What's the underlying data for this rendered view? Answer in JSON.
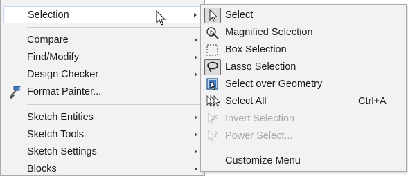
{
  "left_menu": {
    "items": [
      {
        "label": "Selection",
        "has_submenu": true,
        "highlighted": true
      },
      {
        "label": "Compare",
        "has_submenu": true
      },
      {
        "label": "Find/Modify",
        "has_submenu": true
      },
      {
        "label": "Design Checker",
        "has_submenu": true
      },
      {
        "label": "Format Painter...",
        "has_submenu": false,
        "icon": "format-painter-icon"
      },
      {
        "label": "Sketch Entities",
        "has_submenu": true
      },
      {
        "label": "Sketch Tools",
        "has_submenu": true
      },
      {
        "label": "Sketch Settings",
        "has_submenu": true
      },
      {
        "label": "Blocks",
        "has_submenu": true
      }
    ]
  },
  "submenu": {
    "items": [
      {
        "label": "Select",
        "icon": "select-arrow-icon",
        "active": true
      },
      {
        "label": "Magnified Selection",
        "icon": "magnified-selection-icon"
      },
      {
        "label": "Box Selection",
        "icon": "box-selection-icon"
      },
      {
        "label": "Lasso Selection",
        "icon": "lasso-selection-icon",
        "active": true
      },
      {
        "label": "Select over Geometry",
        "icon": "select-over-geometry-icon"
      },
      {
        "label": "Select All",
        "icon": "select-all-icon",
        "shortcut": "Ctrl+A"
      },
      {
        "label": "Invert Selection",
        "icon": "invert-selection-icon",
        "disabled": true
      },
      {
        "label": "Power Select...",
        "icon": "power-select-icon",
        "disabled": true
      },
      {
        "label": "Customize Menu"
      }
    ]
  },
  "colors": {
    "menu_bg": "#f2f2f2",
    "highlight_bg": "#ffffff",
    "disabled_text": "#a8a8a8",
    "accent_blue": "#2f6db5"
  }
}
